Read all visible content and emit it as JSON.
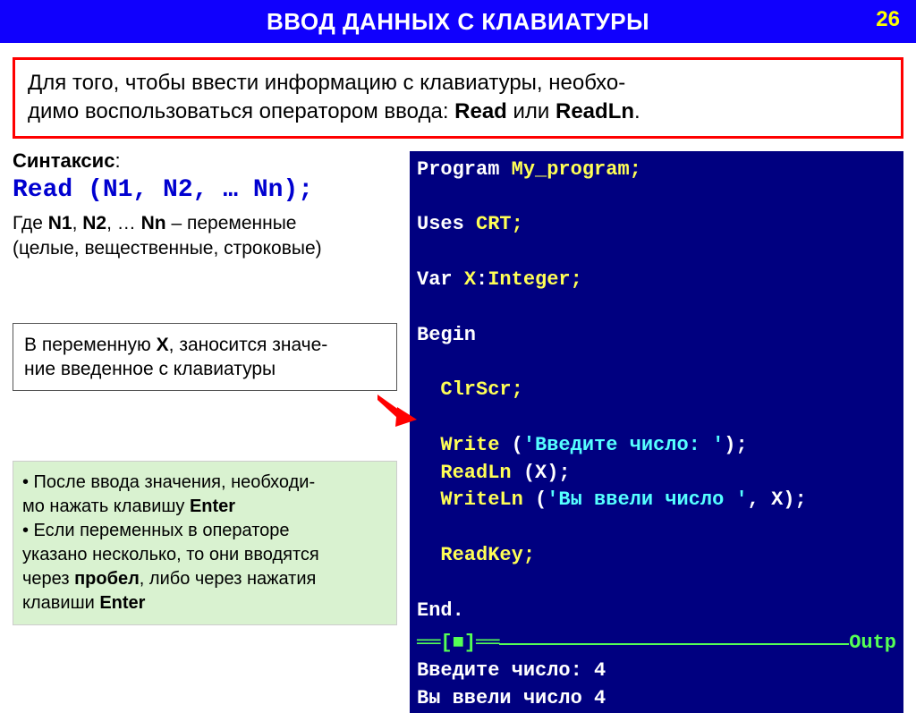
{
  "header": {
    "title": "ВВОД ДАННЫХ С КЛАВИАТУРЫ",
    "slide_number": "26"
  },
  "intro": {
    "line1": "Для того, чтобы ввести информацию с клавиатуры, необхо-",
    "line2_a": "димо воспользоваться оператором ввода: ",
    "kw1": "Read",
    "or": " или ",
    "kw2": "ReadLn",
    "period": "."
  },
  "syntax": {
    "label": "Синтаксис",
    "colon": ":",
    "code": "Read (N1, N2, … Nn);",
    "desc_a": "Где ",
    "n1": "N1",
    "c1": ", ",
    "n2": "N2",
    "c2": ", … ",
    "nn": "Nn",
    "desc_b": " – переменные",
    "desc_line2": "(целые, вещественные, строковые)"
  },
  "box2": {
    "a": "В переменную ",
    "x": "X",
    "b": ", заносится значе-",
    "line2": "ние введенное с клавиатуры"
  },
  "box3": {
    "b1a": "• После ввода значения, необходи-",
    "b1b_a": "мо нажать клавишу ",
    "enter1": "Enter",
    "b2a": "• Если переменных в операторе",
    "b2b": "указано несколько, то они вводятся",
    "b2c_a": "через ",
    "space": "пробел",
    "b2c_b": ", либо через нажатия",
    "b2d_a": "клавиши ",
    "enter2": "Enter"
  },
  "code": {
    "l1_kw": "Program ",
    "l1_id": "My_program;",
    "l2_kw": "Uses ",
    "l2_id": "CRT;",
    "l3_kw": "Var ",
    "l3_id1": "X",
    "l3_colon": ":",
    "l3_id2": "Integer;",
    "l4_kw": "Begin",
    "l5": "  ClrScr;",
    "l6a": "  Write ",
    "l6b": "(",
    "l6c": "'Введите число: '",
    "l6d": ");",
    "l7a": "  ReadLn ",
    "l7b": "(X);",
    "l8a": "  WriteLn ",
    "l8b": "(",
    "l8c": "'Вы ввели число '",
    "l8d": ", X);",
    "l9": "  ReadKey;",
    "l10_kw": "End",
    "l10_dot": ".",
    "sep_left": "══[",
    "sep_bullet": "■",
    "sep_right": "]══",
    "sep_out": " Outp",
    "out1": "Введите число: 4",
    "out2": "Вы ввели число 4"
  }
}
